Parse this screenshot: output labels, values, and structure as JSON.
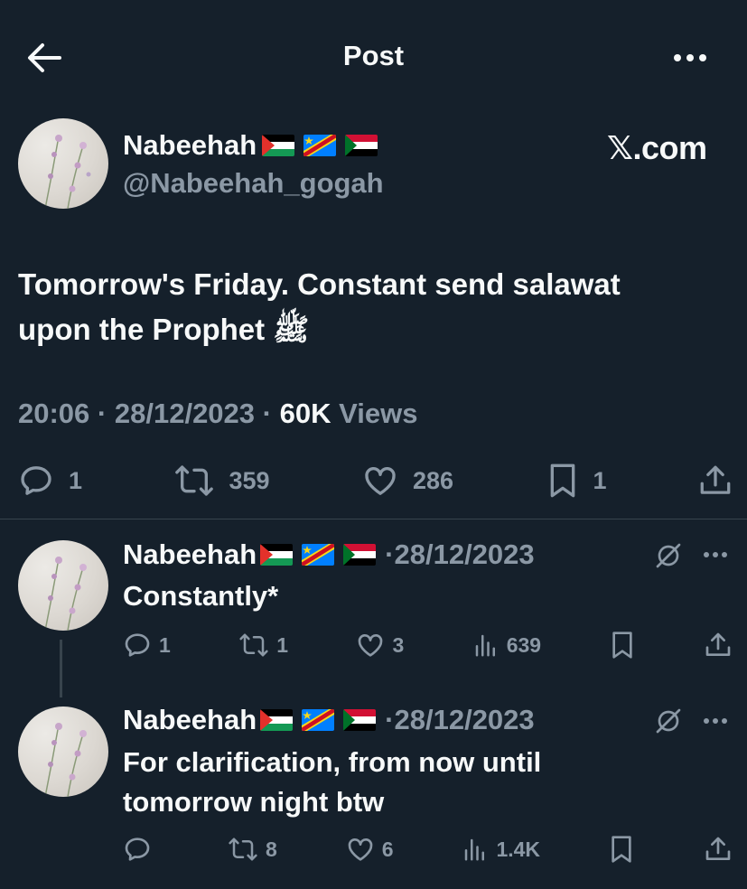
{
  "header": {
    "title": "Post",
    "back_icon": "arrow-left-icon",
    "more_icon": "more-horizontal-icon"
  },
  "post": {
    "display_name": "Nabeehah",
    "flags": [
      "palestine-flag",
      "dr-congo-flag",
      "sudan-flag"
    ],
    "handle": "@Nabeehah_gogah",
    "source": "𝕏.com",
    "text_line1": "Tomorrow's Friday. Constant send salawat",
    "text_line2": "upon the Prophet ﷺ",
    "time": "20:06",
    "date": "28/12/2023",
    "views_count": "60K",
    "views_label": "Views",
    "separator": "·",
    "stats": {
      "replies": "1",
      "reposts": "359",
      "likes": "286",
      "bookmarks": "1"
    }
  },
  "replies": [
    {
      "display_name": "Nabeehah",
      "separator": "·",
      "date": "28/12/2023",
      "text": "Constantly*",
      "stats": {
        "replies": "1",
        "reposts": "1",
        "likes": "3",
        "views": "639"
      }
    },
    {
      "display_name": "Nabeehah",
      "separator": "·",
      "date": "28/12/2023",
      "text": "For clarification, from now until tomorrow night btw",
      "stats": {
        "replies": "",
        "reposts": "8",
        "likes": "6",
        "views": "1.4K"
      }
    }
  ],
  "colors": {
    "background": "#15202b",
    "text": "#f7f9f9",
    "muted": "#8b98a5",
    "divider": "#38444d"
  }
}
